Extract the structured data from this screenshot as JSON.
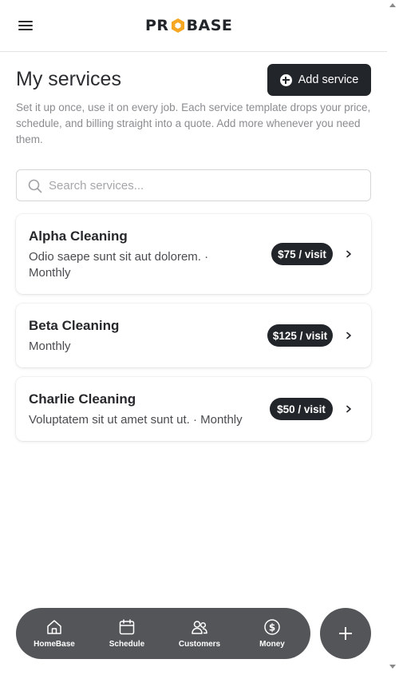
{
  "header": {
    "logo": {
      "left": "PR",
      "right": "BASE",
      "accent": "#f5a623"
    }
  },
  "page": {
    "title": "My services",
    "add_button_label": "Add service",
    "description": "Set it up once, use it on every job. Each service template drops your price, schedule, and billing straight into a quote. Add more whenever you need them."
  },
  "search": {
    "placeholder": "Search services..."
  },
  "services": [
    {
      "name": "Alpha Cleaning",
      "subtitle": "Odio saepe sunt sit aut dolorem. · Monthly",
      "price": "$75 / visit"
    },
    {
      "name": "Beta Cleaning",
      "subtitle": "Monthly",
      "price": "$125 / visit"
    },
    {
      "name": "Charlie Cleaning",
      "subtitle": "Voluptatem sit ut amet sunt ut. · Monthly",
      "price": "$50 / visit"
    }
  ],
  "bottom_nav": {
    "items": [
      {
        "label": "HomeBase",
        "icon": "home-icon"
      },
      {
        "label": "Schedule",
        "icon": "calendar-icon"
      },
      {
        "label": "Customers",
        "icon": "users-icon"
      },
      {
        "label": "Money",
        "icon": "dollar-icon"
      }
    ],
    "fab_icon": "plus-icon"
  },
  "colors": {
    "primary_dark": "#22252a",
    "nav_bg": "#535558",
    "muted_text": "#8a8c90"
  }
}
